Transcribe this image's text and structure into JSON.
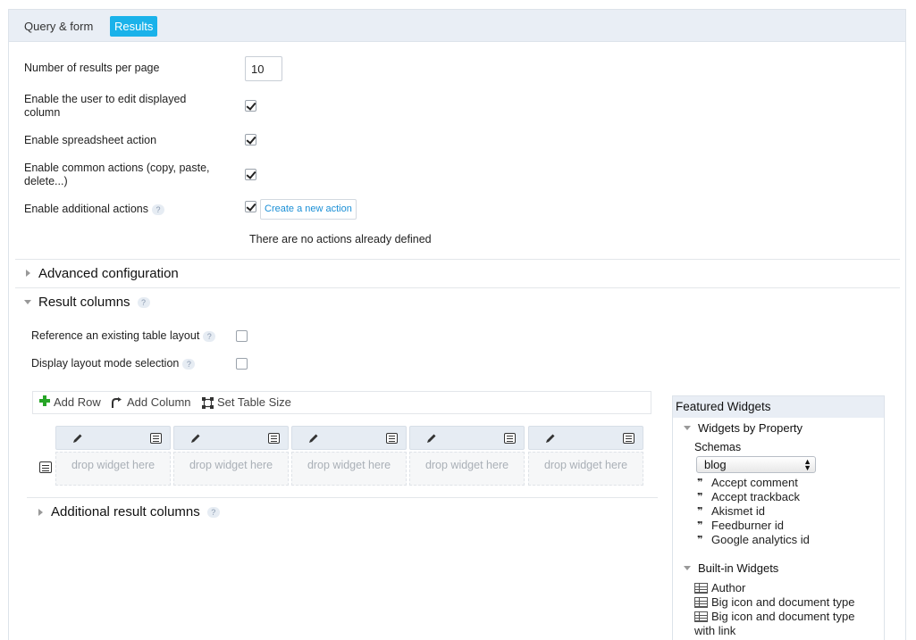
{
  "tabs": [
    {
      "label": "Query & form",
      "active": false
    },
    {
      "label": "Results",
      "active": true
    }
  ],
  "form": {
    "results_per_page_label": "Number of results per page",
    "results_per_page_value": "10",
    "edit_columns_label": "Enable the user to edit displayed column",
    "edit_columns_checked": true,
    "spreadsheet_label": "Enable spreadsheet action",
    "spreadsheet_checked": true,
    "common_actions_label": "Enable common actions (copy, paste, delete...)",
    "common_actions_checked": true,
    "additional_actions_label": "Enable additional actions",
    "additional_actions_checked": true,
    "create_action_label": "Create a new action",
    "no_actions_text": "There are no actions already defined",
    "help_glyph": "?"
  },
  "sections": {
    "advanced_config": "Advanced configuration",
    "result_columns": "Result columns",
    "additional_result_columns": "Additional result columns"
  },
  "result_columns": {
    "reference_layout_label": "Reference an existing table layout",
    "reference_layout_checked": false,
    "layout_mode_label": "Display layout mode selection",
    "layout_mode_checked": false
  },
  "toolbar": {
    "add_row": "Add Row",
    "add_column": "Add Column",
    "set_table_size": "Set Table Size"
  },
  "grid": {
    "drop_text": "drop widget here",
    "cells": [
      {},
      {},
      {},
      {},
      {}
    ]
  },
  "sidebar": {
    "title": "Featured Widgets",
    "by_property": "Widgets by Property",
    "schemas_label": "Schemas",
    "schema_selected": "blog",
    "property_widgets": [
      "Accept comment",
      "Accept trackback",
      "Akismet id",
      "Feedburner id",
      "Google analytics id"
    ],
    "builtin_title": "Built-in Widgets",
    "builtin_widgets": [
      "Author",
      "Big icon and document type",
      "Big icon and document type",
      "with link"
    ]
  },
  "colors": {
    "accent": "#1ab2ea",
    "link": "#1a8fd6",
    "header_bg": "#e9eef5",
    "add_green": "#27a527"
  }
}
